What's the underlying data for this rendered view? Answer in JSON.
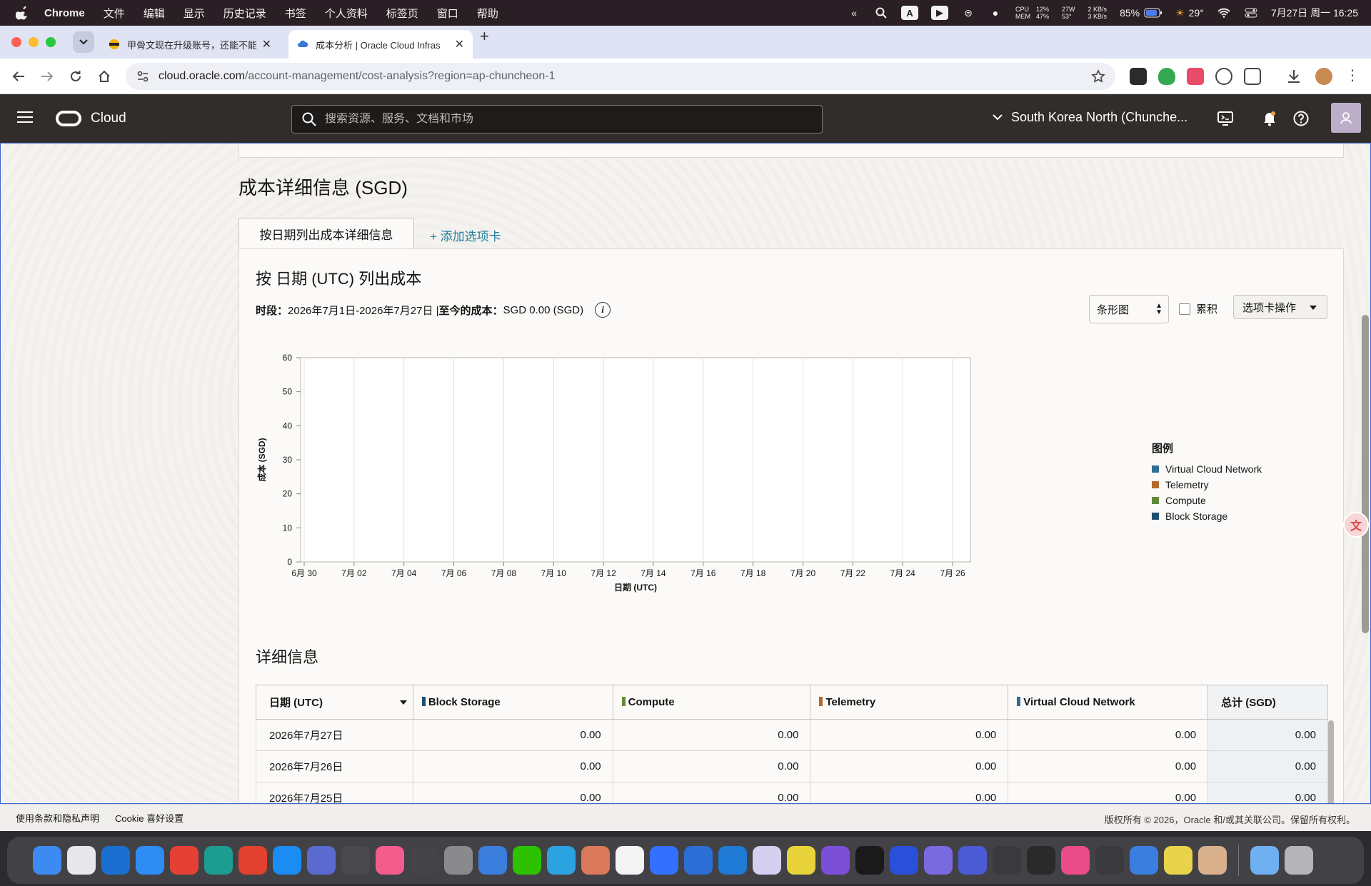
{
  "menubar": {
    "app_name": "Chrome",
    "items": [
      "文件",
      "编辑",
      "显示",
      "历史记录",
      "书签",
      "个人资料",
      "标签页",
      "窗口",
      "帮助"
    ],
    "status": {
      "cpu_label": "CPU",
      "mem_label": "MEM",
      "cpu_value": "12%",
      "mem_value": "47%",
      "power": "27W",
      "temp": "53°",
      "net_up": "2 KB/s",
      "net_down": "3 KB/s",
      "battery": "85%",
      "weather": "29°",
      "datetime": "7月27日 周一  16:25"
    }
  },
  "browser": {
    "tabs": [
      {
        "title": "甲骨文现在升级账号，还能不能",
        "active": false
      },
      {
        "title": "成本分析 | Oracle Cloud Infras",
        "active": true
      }
    ],
    "url_host": "cloud.oracle.com",
    "url_path": "/account-management/cost-analysis?region=ap-chuncheon-1"
  },
  "oci_header": {
    "brand": "Cloud",
    "search_placeholder": "搜索资源、服务、文档和市场",
    "region": "South Korea North (Chunche..."
  },
  "page": {
    "section_title": "成本详细信息 (SGD)",
    "tab_label": "按日期列出成本详细信息",
    "add_tab": "+ 添加选项卡",
    "heading": "按 日期 (UTC) 列出成本",
    "period_label": "时段：",
    "period_value": "2026年7月1日-2026年7月27日 | ",
    "cost_label": "至今的成本：",
    "cost_value": "SGD 0.00 (SGD)",
    "chart_type_select": "条形图",
    "cumulative_label": "累积",
    "tab_actions": "选项卡操作",
    "details_title": "详细信息"
  },
  "colors": {
    "virtual_cloud_network": "#2f6f94",
    "telemetry": "#b46a2a",
    "compute": "#5f8a37",
    "block_storage": "#1f4e6e"
  },
  "chart_data": {
    "type": "bar",
    "categories": [
      "6月 30",
      "7月 02",
      "7月 04",
      "7月 06",
      "7月 08",
      "7月 10",
      "7月 12",
      "7月 14",
      "7月 16",
      "7月 18",
      "7月 20",
      "7月 22",
      "7月 24",
      "7月 26"
    ],
    "xlabel": "日期 (UTC)",
    "ylabel": "成本 (SGD)",
    "ylim": [
      0,
      60
    ],
    "yticks": [
      0,
      10,
      20,
      30,
      40,
      50,
      60
    ],
    "legend_title": "图例",
    "legend_position": "right",
    "grid": true,
    "series": [
      {
        "name": "Virtual Cloud Network",
        "color": "#2f6f94",
        "values": [
          0,
          0,
          0,
          0,
          0,
          0,
          0,
          0,
          0,
          0,
          0,
          0,
          0,
          0
        ]
      },
      {
        "name": "Telemetry",
        "color": "#b46a2a",
        "values": [
          0,
          0,
          0,
          0,
          0,
          0,
          0,
          0,
          0,
          0,
          0,
          0,
          0,
          0
        ]
      },
      {
        "name": "Compute",
        "color": "#5f8a37",
        "values": [
          0,
          0,
          0,
          0,
          0,
          0,
          0,
          0,
          0,
          0,
          0,
          0,
          0,
          0
        ]
      },
      {
        "name": "Block Storage",
        "color": "#1f4e6e",
        "values": [
          0,
          0,
          0,
          0,
          0,
          0,
          0,
          0,
          0,
          0,
          0,
          0,
          0,
          0
        ]
      }
    ]
  },
  "table": {
    "headers": [
      "日期 (UTC)",
      "Block Storage",
      "Compute",
      "Telemetry",
      "Virtual Cloud Network",
      "总计 (SGD)"
    ],
    "rows": [
      [
        "2026年7月27日",
        "0.00",
        "0.00",
        "0.00",
        "0.00",
        "0.00"
      ],
      [
        "2026年7月26日",
        "0.00",
        "0.00",
        "0.00",
        "0.00",
        "0.00"
      ],
      [
        "2026年7月25日",
        "0.00",
        "0.00",
        "0.00",
        "0.00",
        "0.00"
      ]
    ]
  },
  "footer": {
    "terms": "使用条款和隐私声明",
    "cookie": "Cookie 喜好设置",
    "copyright": "版权所有 © 2026，Oracle 和/或其关联公司。保留所有权利。"
  },
  "dock": {
    "apps": [
      {
        "name": "finder",
        "color": "#3d8bf2"
      },
      {
        "name": "launchpad",
        "color": "#e8e8ea"
      },
      {
        "name": "outlook",
        "color": "#1a6fd0"
      },
      {
        "name": "safari",
        "color": "#2f8cf5"
      },
      {
        "name": "chrome",
        "color": "#e44134"
      },
      {
        "name": "edge",
        "color": "#1c9d8f"
      },
      {
        "name": "wps",
        "color": "#e2412f"
      },
      {
        "name": "app-store",
        "color": "#1b8cf4"
      },
      {
        "name": "game-controller",
        "color": "#5b6ad0"
      },
      {
        "name": "notes-board",
        "color": "#4a4a4e"
      },
      {
        "name": "bilibili",
        "color": "#f25d8e"
      },
      {
        "name": "chatgpt",
        "color": "#444448"
      },
      {
        "name": "system-settings",
        "color": "#8a8a8e"
      },
      {
        "name": "paper-plane",
        "color": "#3b7ddd"
      },
      {
        "name": "wechat",
        "color": "#2dc100"
      },
      {
        "name": "telegram",
        "color": "#2aa3e0"
      },
      {
        "name": "claude",
        "color": "#d9785a"
      },
      {
        "name": "typora",
        "color": "#f4f4f4"
      },
      {
        "name": "lark",
        "color": "#3370ff"
      },
      {
        "name": "mail",
        "color": "#2b6fd6"
      },
      {
        "name": "vscode",
        "color": "#1f7ad6"
      },
      {
        "name": "colors",
        "color": "#d4d0f0"
      },
      {
        "name": "yellow-app",
        "color": "#e8d43a"
      },
      {
        "name": "obsidian",
        "color": "#7b4fd6"
      },
      {
        "name": "waveform",
        "color": "#1a1a1a"
      },
      {
        "name": "translate",
        "color": "#2a4fd8"
      },
      {
        "name": "circle-app",
        "color": "#7a6ae0"
      },
      {
        "name": "lasso",
        "color": "#4b5bd6"
      },
      {
        "name": "video-play",
        "color": "#3a3a3e"
      },
      {
        "name": "activity-monitor",
        "color": "#2a2a2a"
      },
      {
        "name": "pink-app",
        "color": "#ea4c89"
      },
      {
        "name": "grid-app",
        "color": "#3a3a3e"
      },
      {
        "name": "blue-app",
        "color": "#3a7ee0"
      },
      {
        "name": "vpn-app",
        "color": "#e9d34a"
      },
      {
        "name": "avatar-app",
        "color": "#d9b08c"
      },
      {
        "name": "folder",
        "color": "#6fb1f0"
      },
      {
        "name": "trash",
        "color": "#b5b5b8"
      }
    ]
  }
}
